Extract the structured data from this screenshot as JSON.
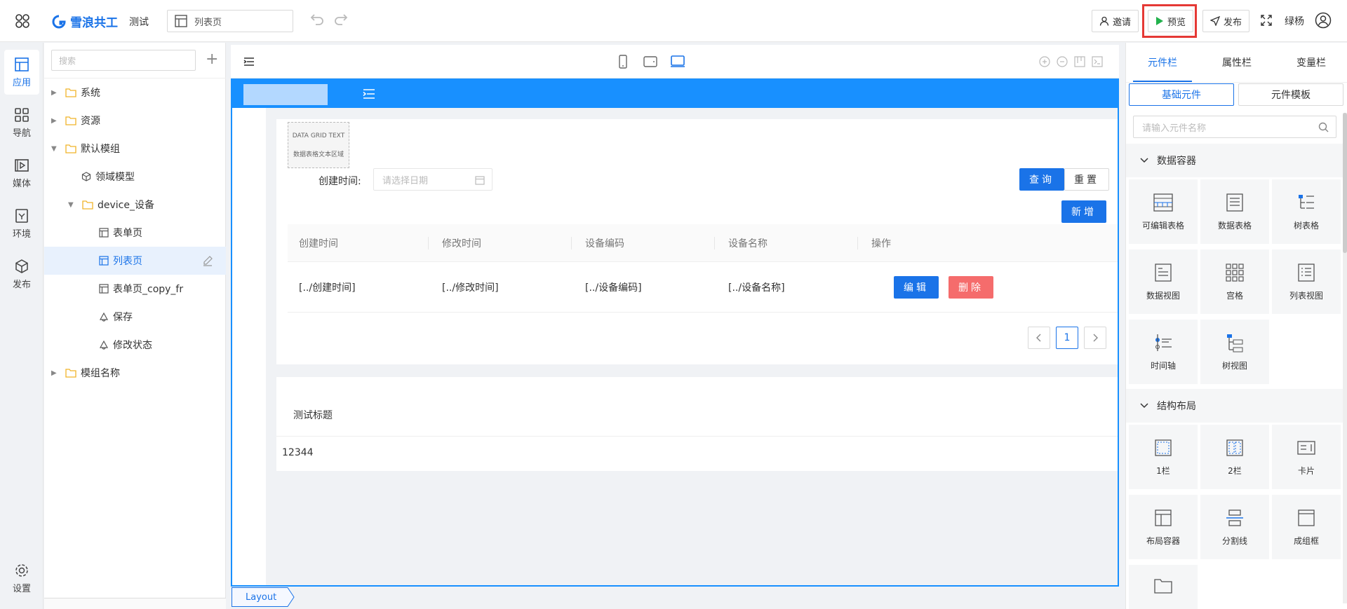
{
  "topbar": {
    "logo_text": "雪浪共工",
    "project_name": "测试",
    "current_page": "列表页",
    "invite_label": "邀请",
    "preview_label": "预览",
    "publish_label": "发布",
    "user_name": "绿杨"
  },
  "leftnav": {
    "items": [
      {
        "label": "应用",
        "icon": "layout-icon"
      },
      {
        "label": "导航",
        "icon": "grid-icon"
      },
      {
        "label": "媒体",
        "icon": "media-icon"
      },
      {
        "label": "环境",
        "icon": "environment-icon"
      },
      {
        "label": "发布",
        "icon": "cube-icon"
      }
    ],
    "settings_label": "设置"
  },
  "tree": {
    "search_placeholder": "搜索",
    "items": [
      {
        "label": "系统"
      },
      {
        "label": "资源"
      },
      {
        "label": "默认模组"
      },
      {
        "label": "领域模型"
      },
      {
        "label": "device_设备"
      },
      {
        "label": "表单页"
      },
      {
        "label": "列表页"
      },
      {
        "label": "表单页_copy_fr"
      },
      {
        "label": "保存"
      },
      {
        "label": "修改状态"
      },
      {
        "label": "模组名称"
      }
    ]
  },
  "canvas": {
    "data_grid_title": "DATA GRID TEXT",
    "data_grid_subtitle": "数据表格文本区域",
    "filter_label": "创建时间:",
    "date_placeholder": "请选择日期",
    "query_label": "查询",
    "reset_label": "重置",
    "add_label": "新增",
    "table": {
      "headers": [
        "创建时间",
        "修改时间",
        "设备编码",
        "设备名称",
        "操作"
      ],
      "row": [
        "[../创建时间]",
        "[../修改时间]",
        "[../设备编码]",
        "[../设备名称]"
      ],
      "edit_label": "编辑",
      "delete_label": "删除"
    },
    "pagination_current": "1",
    "card_title": "测试标题",
    "card_value": "12344",
    "layout_tab": "Layout"
  },
  "rightpanel": {
    "tabs": [
      "元件栏",
      "属性栏",
      "变量栏"
    ],
    "segments": [
      "基础元件",
      "元件模板"
    ],
    "search_placeholder": "请输入元件名称",
    "sections": [
      {
        "title": "数据容器",
        "items": [
          "可编辑表格",
          "数据表格",
          "树表格",
          "数据视图",
          "宫格",
          "列表视图",
          "时间轴",
          "树视图"
        ]
      },
      {
        "title": "结构布局",
        "items": [
          "1栏",
          "2栏",
          "卡片",
          "布局容器",
          "分割线",
          "成组框"
        ]
      }
    ]
  }
}
